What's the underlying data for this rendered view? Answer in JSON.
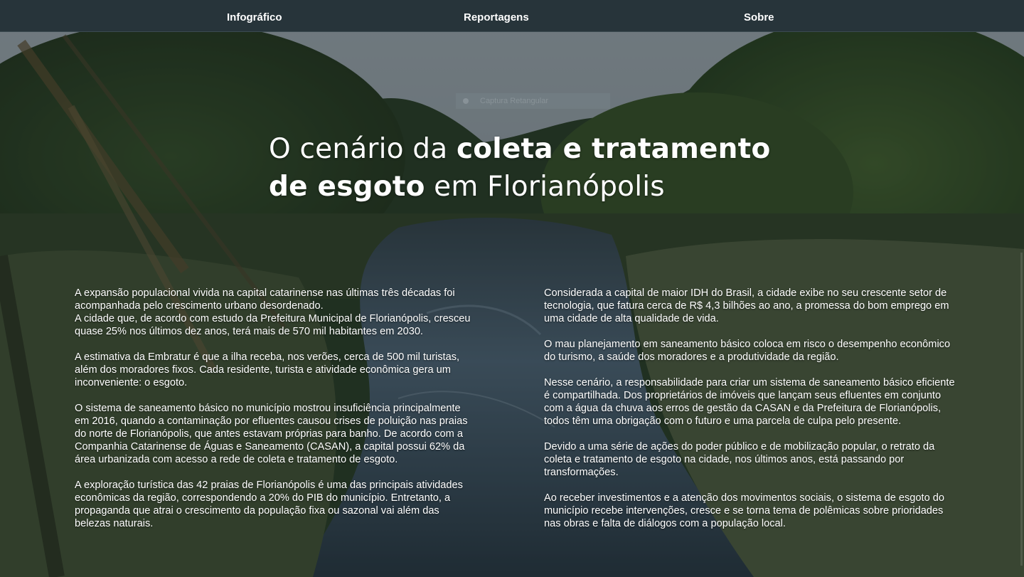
{
  "nav": {
    "items": [
      "Infográfico",
      "Reportagens",
      "Sobre"
    ]
  },
  "capture_chip": {
    "label": "Captura Retangular"
  },
  "hero": {
    "title_part1": "O cenário da ",
    "title_bold1": "coleta e tratamento",
    "title_bold2": "de esgoto",
    "title_part2": " em Florianópolis"
  },
  "left_column": {
    "p1_a": "A expansão populacional vivida na capital catarinense nas últimas três décadas foi acompanhada pelo crescimento urbano desordenado.",
    "p1_b": "A cidade que, de acordo com estudo da Prefeitura Municipal de  Florianópolis, cresceu quase 25% nos últimos dez anos, terá mais de  570 mil habitantes em 2030.",
    "p2": "A estimativa da Embratur é que a ilha receba, nos verões, cerca de 500 mil turistas, além dos moradores fixos. Cada residente, turista e atividade econômica gera um inconveniente: o esgoto.",
    "p3": "O sistema de saneamento básico no município mostrou insuficiência principalmente em 2016, quando a contaminação por efluentes causou crises de poluição nas praias do norte de Florianópolis, que antes estavam próprias para banho. De acordo com a Companhia Catarinense de Águas e Saneamento (CASAN), a capital possui 62% da área urbanizada com acesso a rede de coleta e tratamento de esgoto.",
    "p4": "A exploração turística das 42 praias de Florianópolis é uma das principais atividades econômicas da região, correspondendo a 20% do PIB do município. Entretanto, a propaganda que atrai o crescimento da população fixa ou sazonal vai além das belezas naturais."
  },
  "right_column": {
    "p1": "Considerada a capital de maior IDH do Brasil, a cidade exibe no seu crescente setor de tecnologia, que fatura cerca de R$ 4,3 bilhões ao ano, a promessa do bom emprego em uma cidade de alta qualidade de vida.",
    "p2": "O mau planejamento em saneamento básico coloca em risco o desempenho econômico do turismo, a saúde dos moradores e a produtividade da região.",
    "p3": "Nesse cenário, a responsabilidade para criar um sistema de saneamento básico eficiente é compartilhada. Dos proprietários de imóveis que lançam seus efluentes em conjunto com a água da chuva aos erros de gestão da CASAN e da Prefeitura de Florianópolis, todos têm uma obrigação com o futuro e uma parcela de culpa pelo presente.",
    "p4": "Devido a uma série de ações do poder público e de mobilização popular, o retrato da coleta e tratamento de esgoto na cidade, nos últimos anos, está passando por transformações.",
    "p5": "Ao receber investimentos e a atenção dos movimentos sociais, o sistema de esgoto do município recebe intervenções, cresce e se torna tema de polêmicas sobre prioridades nas obras e falta de diálogos com a população local."
  },
  "colors": {
    "navbar": "#27343a",
    "text": "#ffffff",
    "overlay": "rgba(12,18,22,0.42)"
  }
}
